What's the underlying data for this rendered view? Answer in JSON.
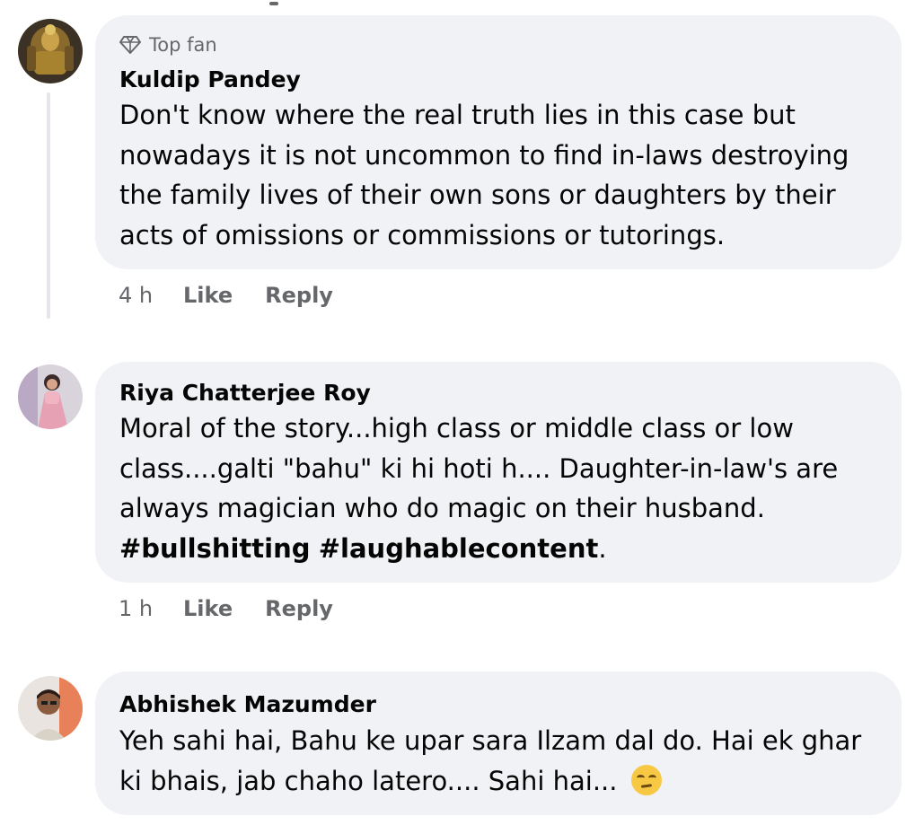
{
  "comments": [
    {
      "badge": "Top fan",
      "author": "Kuldip Pandey",
      "lines": [
        "Don't know where the real truth lies in this case but",
        "nowadays it is not uncommon to find in-laws destroying",
        "the family lives of their own sons or daughters by their",
        "acts of omissions or commissions or tutorings."
      ],
      "time": "4 h",
      "like": "Like",
      "reply": "Reply"
    },
    {
      "author": "Riya Chatterjee Roy",
      "lines": [
        "Moral of the story...high class or middle class or low",
        "class....galti \"bahu\" ki hi hoti h.... Daughter-in-law's are",
        "always magician who do magic on their husband."
      ],
      "hashtags": [
        "#bullshitting",
        "#laughablecontent"
      ],
      "hashtag_end": ".",
      "time": "1 h",
      "like": "Like",
      "reply": "Reply"
    },
    {
      "author": "Abhishek Mazumder",
      "lines": [
        "Yeh sahi hai, Bahu ke upar sara Ilzam dal do. Hai ek ghar",
        "ki bhais, jab chaho latero.... Sahi hai..."
      ],
      "emoji": "unamused-face"
    }
  ],
  "icons": {
    "badge_icon": "diamond-icon"
  },
  "colors": {
    "bubble": "#f0f2f5",
    "meta_text": "#65676b",
    "text": "#050505"
  }
}
